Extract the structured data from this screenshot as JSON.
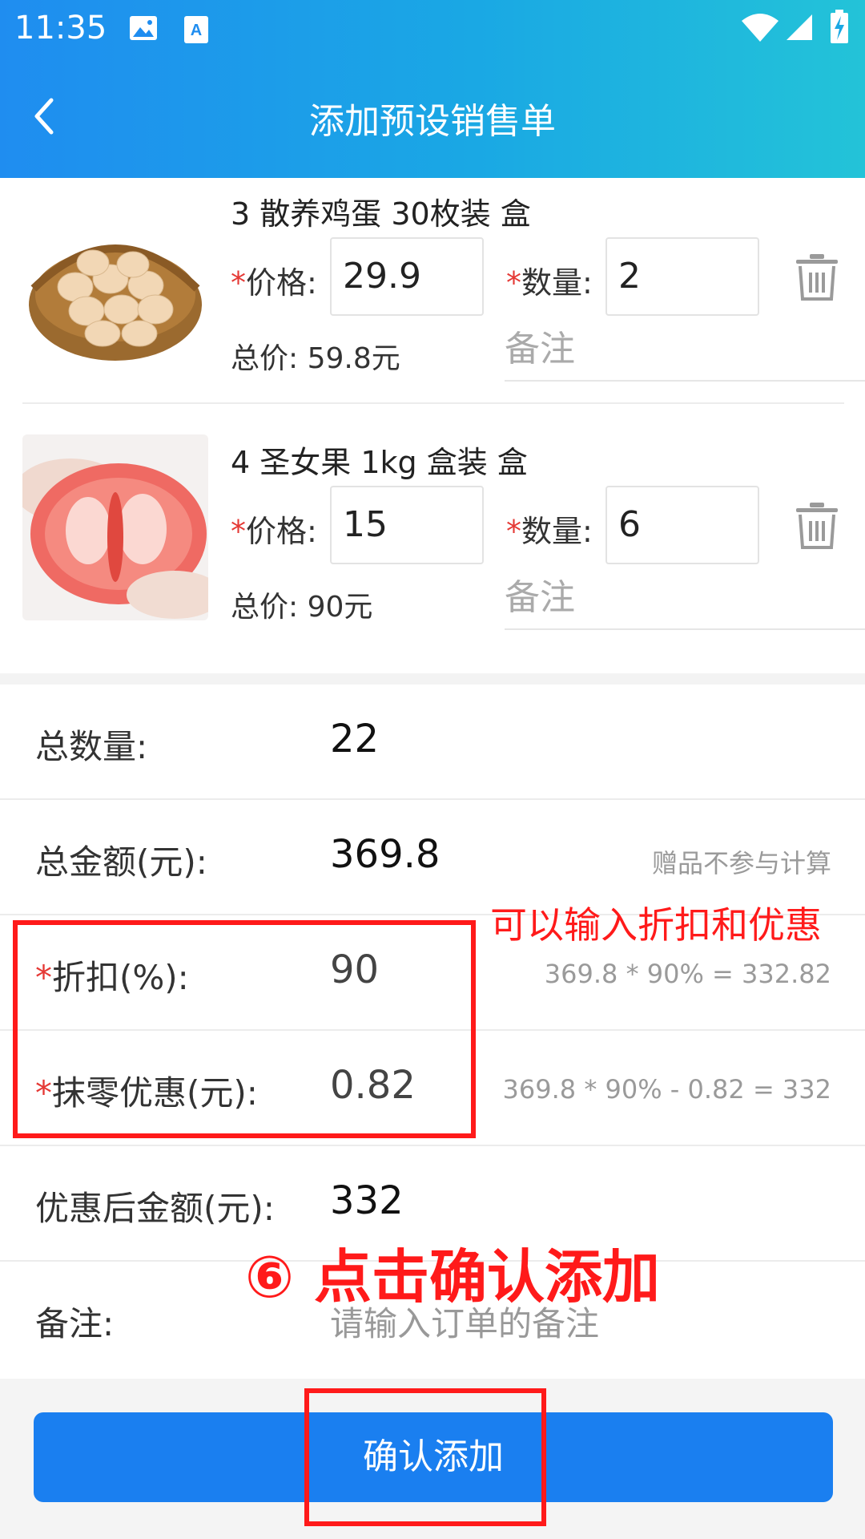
{
  "status_bar": {
    "time": "11:35"
  },
  "header": {
    "title": "添加预设销售单"
  },
  "products": [
    {
      "name": "3 散养鸡蛋 30枚装 盒",
      "price_label": "价格:",
      "price": "29.9",
      "qty_label": "数量:",
      "qty": "2",
      "total": "总价: 59.8元",
      "remark_placeholder": "备注",
      "required_mark": "*"
    },
    {
      "name": "4 圣女果 1kg 盒装 盒",
      "price_label": "价格:",
      "price": "15",
      "qty_label": "数量:",
      "qty": "6",
      "total": "总价: 90元",
      "remark_placeholder": "备注",
      "required_mark": "*"
    }
  ],
  "summary": {
    "total_qty_label": "总数量:",
    "total_qty": "22",
    "total_amount_label": "总金额(元):",
    "total_amount": "369.8",
    "gift_hint": "赠品不参与计算",
    "discount_label": "折扣(%):",
    "discount": "90",
    "discount_hint": "369.8 * 90% = 332.82",
    "rounding_label": "抹零优惠(元):",
    "rounding": "0.82",
    "rounding_hint": "369.8 * 90% - 0.82 = 332",
    "final_label": "优惠后金额(元):",
    "final": "332",
    "remark_label": "备注:",
    "remark_placeholder": "请输入订单的备注",
    "required_mark": "*"
  },
  "confirm_button": "确认添加",
  "annotations": {
    "discount_note": "可以输入折扣和优惠",
    "step_note": "⑥ 点击确认添加"
  },
  "colors": {
    "header_start": "#1f8df0",
    "header_end": "#23c3d8",
    "button": "#1a7ff0",
    "annotation": "#ff1a1a",
    "required": "#e53935"
  }
}
